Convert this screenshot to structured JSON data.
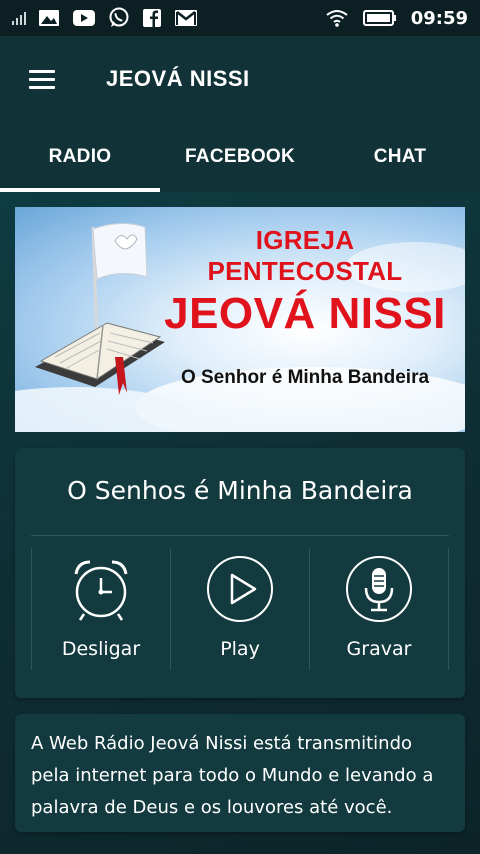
{
  "status_bar": {
    "time": "09:59",
    "icons": [
      "signal-icon",
      "gallery-icon",
      "youtube-icon",
      "whatsapp-icon",
      "facebook-icon",
      "gmail-icon",
      "wifi-icon",
      "battery-icon"
    ]
  },
  "app_bar": {
    "title": "JEOVÁ NISSI"
  },
  "tabs": [
    {
      "label": "RADIO",
      "active": true
    },
    {
      "label": "FACEBOOK",
      "active": false
    },
    {
      "label": "CHAT",
      "active": false
    }
  ],
  "banner": {
    "line1": "IGREJA PENTECOSTAL",
    "line2": "JEOVÁ NISSI",
    "line3": "O Senhor é Minha Bandeira"
  },
  "player": {
    "title": "O Senhos é Minha Bandeira",
    "controls": [
      {
        "label": "Desligar",
        "icon": "alarm-clock-icon"
      },
      {
        "label": "Play",
        "icon": "play-icon"
      },
      {
        "label": "Gravar",
        "icon": "microphone-icon"
      }
    ]
  },
  "info": {
    "text": "A Web Rádio Jeová Nissi está transmitindo pela internet para todo o Mundo e levando a palavra de Deus e os louvores até você."
  },
  "colors": {
    "background": "#0f2f33",
    "app_bar": "#113236",
    "card": "#133a3e",
    "banner_red": "#e0131c"
  }
}
